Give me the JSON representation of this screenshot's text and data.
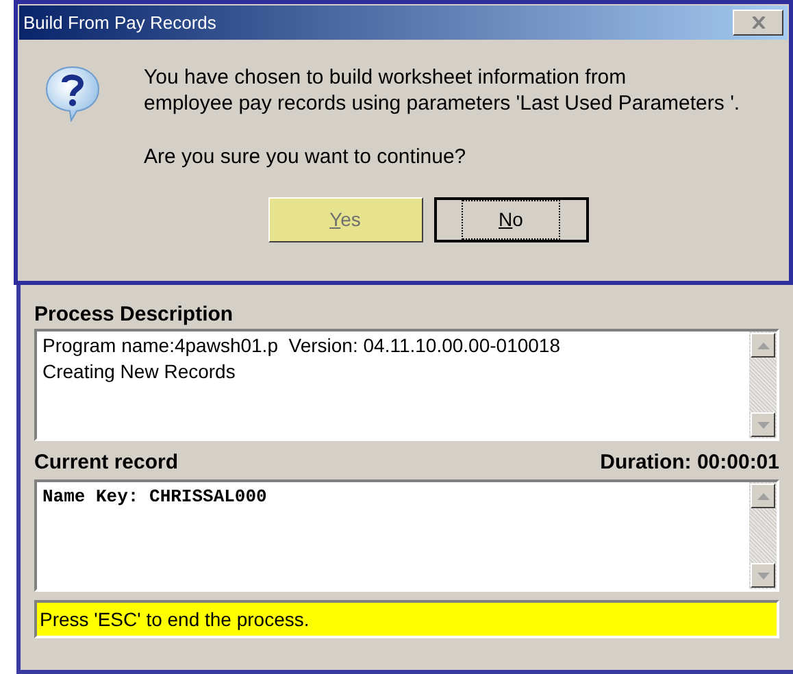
{
  "dialog": {
    "title": "Build From Pay Records",
    "message_lines": [
      "You have chosen to build worksheet information from",
      "employee pay records using parameters 'Last Used Parameters '."
    ],
    "question": "Are you sure you want to continue?",
    "buttons": [
      {
        "label": "Yes",
        "hovered": true,
        "focused": false
      },
      {
        "label": "No",
        "hovered": false,
        "focused": true
      }
    ]
  },
  "window": {
    "process_description": {
      "label": "Process Description",
      "lines": [
        "Program name:4pawsh01.p  Version: 04.11.10.00.00-010018",
        "Creating New Records"
      ]
    },
    "current_record": {
      "label": "Current record",
      "duration": "Duration: 00:00:01",
      "lines": [
        "Name Key: CHRISSAL000"
      ]
    },
    "status": "Press 'ESC' to end the process."
  }
}
